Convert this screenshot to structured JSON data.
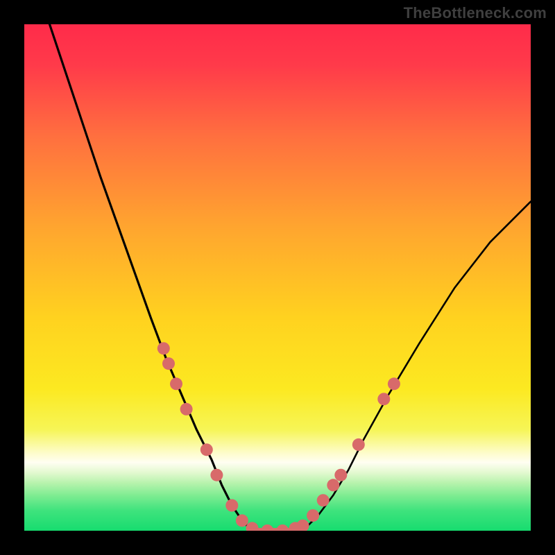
{
  "watermark": "TheBottleneck.com",
  "chart_data": {
    "type": "line",
    "title": "",
    "xlabel": "",
    "ylabel": "",
    "xlim": [
      0,
      100
    ],
    "ylim": [
      0,
      100
    ],
    "series": [
      {
        "name": "left-curve",
        "x": [
          5,
          10,
          15,
          20,
          25,
          28,
          31,
          34,
          37,
          39,
          41,
          43,
          45
        ],
        "y": [
          100,
          85,
          70,
          56,
          42,
          34,
          27,
          20,
          14,
          9,
          5,
          2,
          0
        ]
      },
      {
        "name": "right-curve",
        "x": [
          55,
          58,
          61,
          64,
          67,
          72,
          78,
          85,
          92,
          100
        ],
        "y": [
          0,
          3,
          7,
          12,
          18,
          27,
          37,
          48,
          57,
          65
        ]
      },
      {
        "name": "valley-floor",
        "x": [
          45,
          55
        ],
        "y": [
          0,
          0
        ]
      }
    ],
    "markers": {
      "name": "left-dots-and-right-dots",
      "color": "#d86a6a",
      "radius_px": 9,
      "points_xy": [
        [
          27.5,
          36
        ],
        [
          28.5,
          33
        ],
        [
          30,
          29
        ],
        [
          32,
          24
        ],
        [
          36,
          16
        ],
        [
          38,
          11
        ],
        [
          41,
          5
        ],
        [
          43,
          2
        ],
        [
          45,
          0.5
        ],
        [
          48,
          0
        ],
        [
          51,
          0
        ],
        [
          53.5,
          0.5
        ],
        [
          55,
          1
        ],
        [
          57,
          3
        ],
        [
          59,
          6
        ],
        [
          61,
          9
        ],
        [
          62.5,
          11
        ],
        [
          66,
          17
        ],
        [
          71,
          26
        ],
        [
          73,
          29
        ]
      ]
    },
    "gradient_stops": [
      {
        "offset": 0.0,
        "color": "#ff2b4a"
      },
      {
        "offset": 0.08,
        "color": "#ff3a4a"
      },
      {
        "offset": 0.22,
        "color": "#ff6f3f"
      },
      {
        "offset": 0.4,
        "color": "#ffa52f"
      },
      {
        "offset": 0.58,
        "color": "#ffd21f"
      },
      {
        "offset": 0.72,
        "color": "#fce921"
      },
      {
        "offset": 0.8,
        "color": "#f6f556"
      },
      {
        "offset": 0.845,
        "color": "#fdfcc7"
      },
      {
        "offset": 0.865,
        "color": "#fffef2"
      },
      {
        "offset": 0.885,
        "color": "#e3f9d0"
      },
      {
        "offset": 0.905,
        "color": "#b9f3ae"
      },
      {
        "offset": 0.93,
        "color": "#7fec92"
      },
      {
        "offset": 0.96,
        "color": "#3fe37d"
      },
      {
        "offset": 1.0,
        "color": "#17dc6f"
      }
    ]
  }
}
